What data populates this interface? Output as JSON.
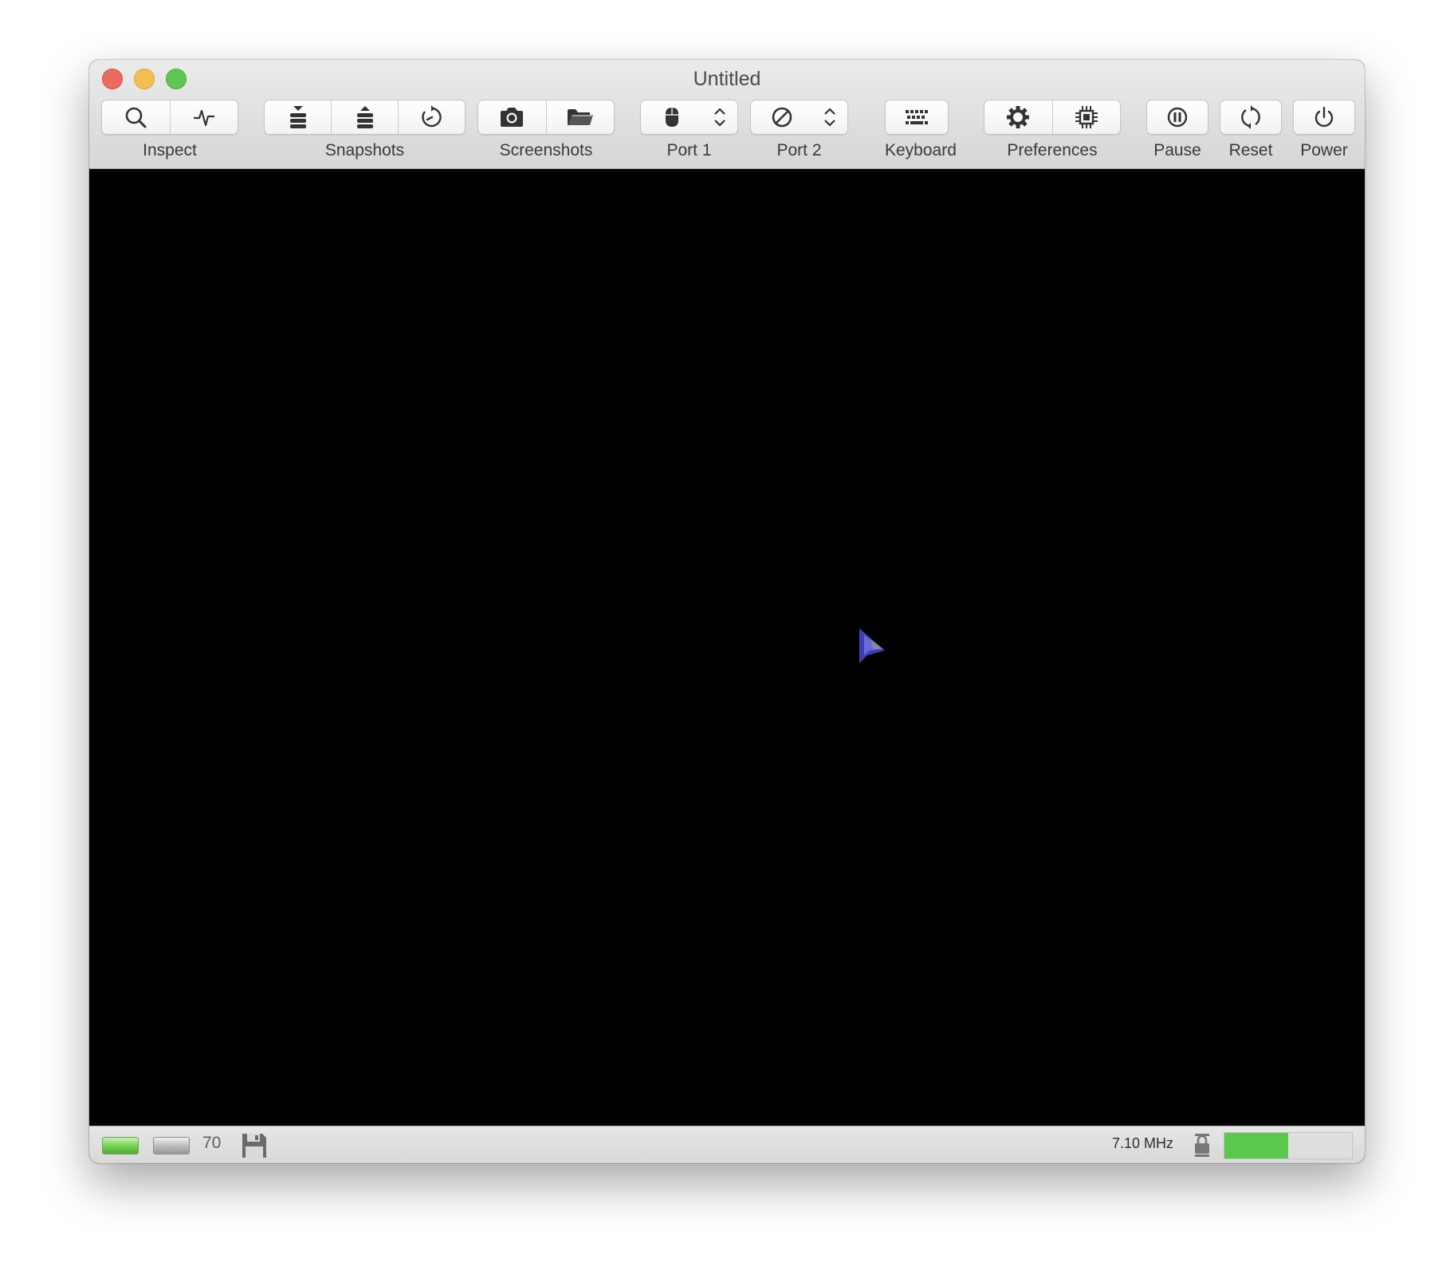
{
  "window": {
    "title": "Untitled"
  },
  "toolbar": {
    "groups": [
      {
        "label": "Inspect",
        "icons": [
          "magnifier-icon",
          "activity-monitor-icon"
        ]
      },
      {
        "label": "Snapshots",
        "icons": [
          "take-snapshot-icon",
          "restore-snapshot-icon",
          "browse-snapshots-icon"
        ]
      },
      {
        "label": "Screenshots",
        "icons": [
          "camera-icon",
          "folder-icon"
        ]
      },
      {
        "label": "Port 1",
        "icons": [
          "mouse-icon",
          "up-down-chevron-icon"
        ]
      },
      {
        "label": "Port 2",
        "icons": [
          "none-icon",
          "up-down-chevron-icon"
        ]
      },
      {
        "label": "Keyboard",
        "icons": [
          "keyboard-icon"
        ]
      },
      {
        "label": "Preferences",
        "icons": [
          "gear-icon",
          "chip-icon"
        ]
      },
      {
        "label": "Pause",
        "icons": [
          "pause-icon"
        ]
      },
      {
        "label": "Reset",
        "icons": [
          "reset-icon"
        ]
      },
      {
        "label": "Power",
        "icons": [
          "power-icon"
        ]
      }
    ]
  },
  "statusbar": {
    "led1_color": "#6fcf4d",
    "led2_color": "#b9b9b9",
    "track": "70",
    "clock": "7.10 MHz",
    "speed_fraction": 0.5,
    "speed_color": "#5ac84c"
  }
}
